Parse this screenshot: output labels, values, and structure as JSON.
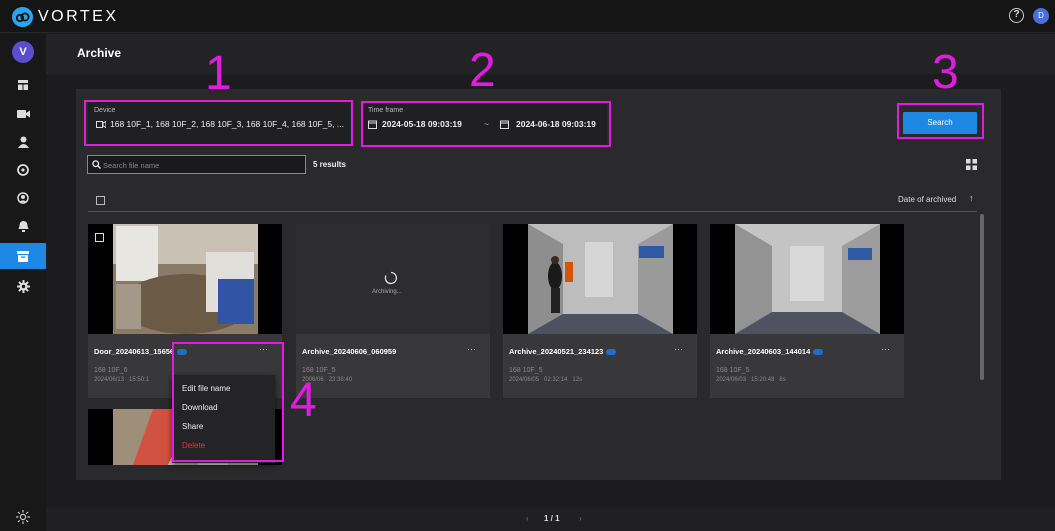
{
  "app": {
    "name": "VORTEX",
    "help_glyph": "?",
    "user_initial": "D",
    "sidebar_avatar": "V"
  },
  "sidebar": {
    "items": [
      {
        "icon": "dashboard-icon"
      },
      {
        "icon": "camera-icon"
      },
      {
        "icon": "person-icon"
      },
      {
        "icon": "tag-icon"
      },
      {
        "icon": "face-icon"
      },
      {
        "icon": "bell-icon"
      },
      {
        "icon": "archive-icon",
        "active": true
      },
      {
        "icon": "gear-icon"
      }
    ],
    "bottom_icon": "brightness-icon"
  },
  "page": {
    "title": "Archive"
  },
  "filters": {
    "device_label": "Device",
    "device_value": "168 10F_1, 168 10F_2, 168 10F_3, 168 10F_4, 168 10F_5, ...",
    "timeframe_label": "Time frame",
    "start": "2024-05-18  09:03:19",
    "separator": "~",
    "end": "2024-06-18  09:03:19",
    "search_label": "Search"
  },
  "search": {
    "placeholder": "Search file name"
  },
  "results": "5 results",
  "sort": {
    "label": "Date of archived",
    "arrow": "↑"
  },
  "cards": [
    {
      "title": "Door_20240613_15",
      "title_tail": "656",
      "device": "168 10F_6",
      "date": "2024/06/13",
      "time": "15:50:1",
      "duration": ""
    },
    {
      "title": "Archive_20240606_060959",
      "title_tail": "",
      "device": "168 10F_5",
      "date": "20",
      "date_tail": "06/06",
      "time": "23:38:40",
      "duration": "",
      "status": "Archiving..."
    },
    {
      "title": "Archive_20240521_234123",
      "title_tail": "",
      "device": "168 10F_5",
      "date": "2024/06/05",
      "time": "02:32:14",
      "duration": "12s"
    },
    {
      "title": "Archive_20240603_144014",
      "title_tail": "",
      "device": "168 10F_5",
      "date": "2024/06/03",
      "time": "15:20:48",
      "duration": "8s"
    }
  ],
  "card_menu": {
    "dots": "···",
    "items": [
      "Edit file name",
      "Download",
      "Share",
      "Delete"
    ]
  },
  "pagination": {
    "prev": "‹",
    "text": "1 / 1",
    "next": "›"
  },
  "annotations": [
    "1",
    "2",
    "3",
    "4"
  ],
  "colors": {
    "accent": "#1e88e5",
    "annotation": "#e11ce0",
    "delete": "#e53935"
  }
}
